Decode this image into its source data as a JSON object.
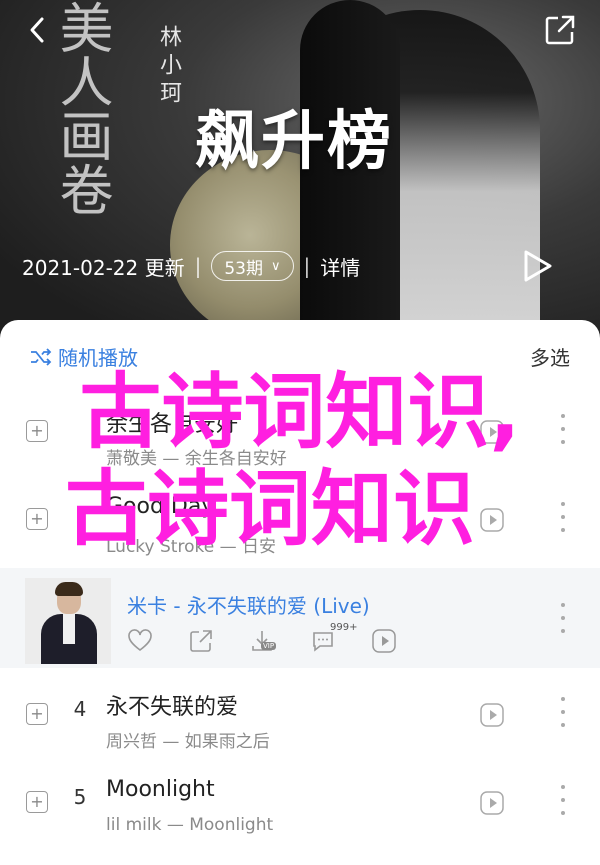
{
  "header": {
    "deco_vertical": "美人画卷",
    "deco_small": "林小珂",
    "title": "飙升榜",
    "date": "2021-02-22 更新",
    "count": "53期",
    "details": "详情"
  },
  "panel": {
    "shuffle_label": "随机播放",
    "multi_select": "多选"
  },
  "rows": [
    {
      "num": "",
      "title": "余生各自安好",
      "artist": "萧敬美 — 余生各自安好"
    },
    {
      "num": "",
      "title": "Good Day",
      "artist": "Lucky Stroke — 日安"
    },
    {
      "num": "4",
      "title": "永不失联的爱",
      "artist": "周兴哲 — 如果雨之后"
    },
    {
      "num": "5",
      "title": "Moonlight",
      "artist": "lil milk — Moonlight"
    }
  ],
  "playing": {
    "title": "米卡 - 永不失联的爱 (Live)",
    "comment_count": "999+",
    "vip_label": "VIP"
  },
  "overlay": {
    "line1": "古诗词知识,",
    "line2": "古诗词知识"
  },
  "colors": {
    "accent": "#3a80e0",
    "overlay": "#ff1fe0",
    "rank_red": "#e84040"
  }
}
